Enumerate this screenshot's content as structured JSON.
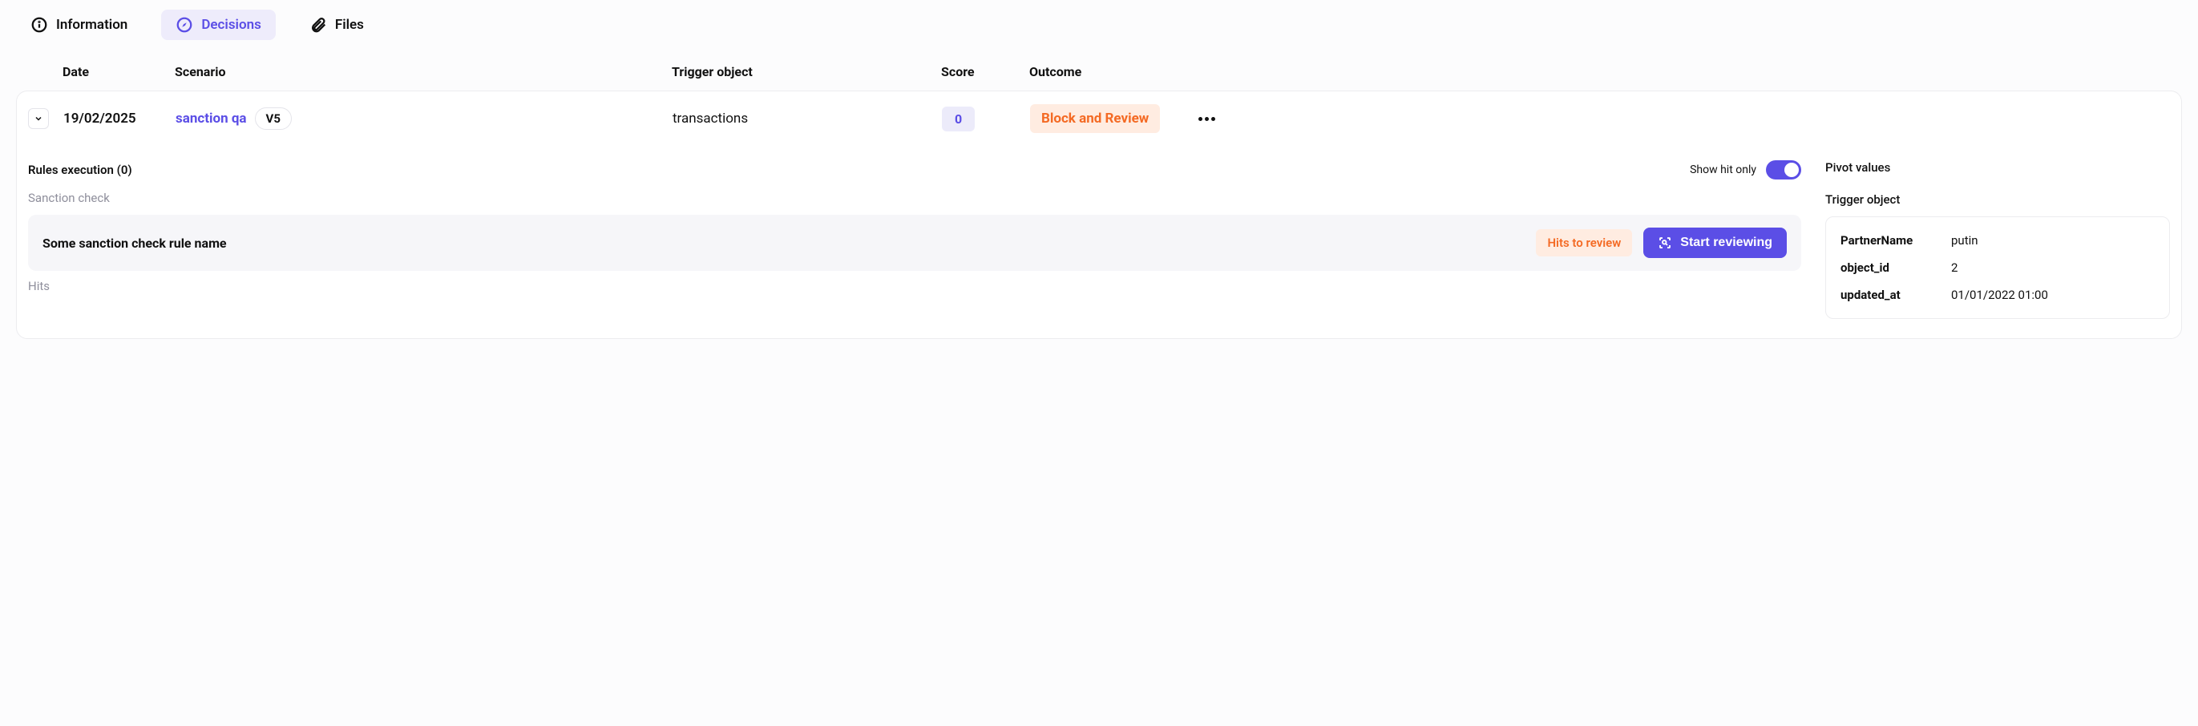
{
  "tabs": {
    "information": "Information",
    "decisions": "Decisions",
    "files": "Files"
  },
  "headers": {
    "date": "Date",
    "scenario": "Scenario",
    "trigger": "Trigger object",
    "score": "Score",
    "outcome": "Outcome"
  },
  "decision": {
    "date": "19/02/2025",
    "scenario": "sanction qa",
    "version": "V5",
    "trigger": "transactions",
    "score": "0",
    "outcome": "Block and Review"
  },
  "left": {
    "rules_execution": "Rules execution (0)",
    "show_hit_only": "Show hit only",
    "sanction_check": "Sanction check",
    "rule_name": "Some sanction check rule name",
    "hits_to_review": "Hits to review",
    "start_reviewing": "Start reviewing",
    "hits": "Hits"
  },
  "right": {
    "pivot_values": "Pivot values",
    "trigger_object": "Trigger object",
    "rows": [
      {
        "key": "PartnerName",
        "val": "putin"
      },
      {
        "key": "object_id",
        "val": "2"
      },
      {
        "key": "updated_at",
        "val": "01/01/2022 01:00"
      }
    ]
  }
}
